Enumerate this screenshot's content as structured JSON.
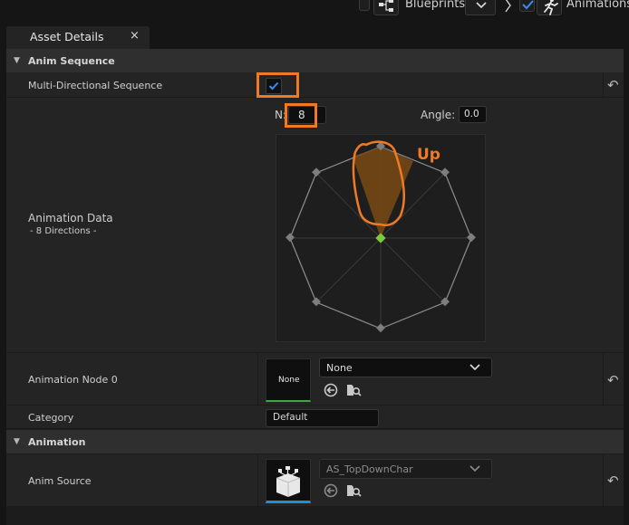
{
  "toolbar": {
    "blueprints_label": "Blueprints",
    "animations_label": "Animations"
  },
  "tab": {
    "title": "Asset Details",
    "close_glyph": "×"
  },
  "sections": {
    "anim_sequence": "Anim Sequence",
    "animation": "Animation"
  },
  "properties": {
    "multi_directional": {
      "label": "Multi-Directional Sequence",
      "checked": true
    },
    "animation_data": {
      "label": "Animation Data",
      "sublabel": "- 8 Directions -",
      "n_label": "N:",
      "n_value": "8",
      "angle_label": "Angle:",
      "angle_value": "0.0",
      "annotation": "Up"
    },
    "animation_node": {
      "label": "Animation Node 0",
      "thumb_text": "None",
      "value": "None"
    },
    "category": {
      "label": "Category",
      "value": "Default"
    },
    "anim_source": {
      "label": "Anim Source",
      "value": "AS_TopDownChar"
    }
  },
  "colors": {
    "accent_orange": "#f07a24",
    "check_blue": "#3b8cf0",
    "dot_green": "#7cc93a",
    "panel_bg": "#242424"
  }
}
